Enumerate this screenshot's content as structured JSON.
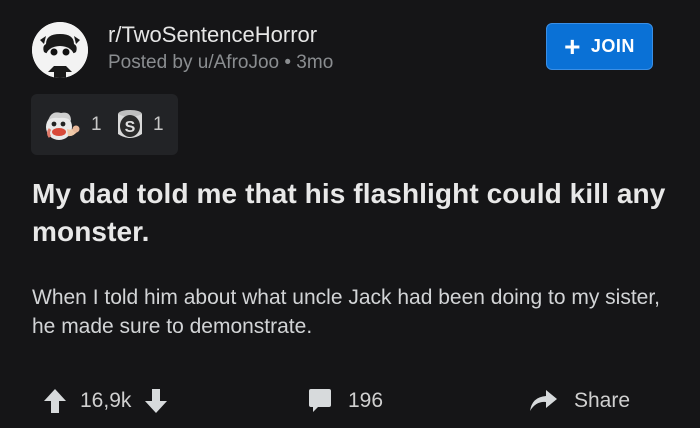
{
  "post": {
    "subreddit": "r/TwoSentenceHorror",
    "posted_by": "Posted by u/AfroJoo • 3mo",
    "join_label": "JOIN",
    "awards": [
      {
        "icon": "wholesome-award-icon",
        "count": "1"
      },
      {
        "icon": "silver-award-icon",
        "count": "1"
      }
    ],
    "title": "My dad told me that his flashlight could kill any monster.",
    "body": "When I told him about what uncle Jack had been doing to my sister, he made sure to demonstrate.",
    "votes": "16,9k",
    "comments": "196",
    "share_label": "Share"
  },
  "colors": {
    "background": "#151517",
    "accent": "#0a71d6",
    "text": "#d7dadc",
    "muted": "#8a8d90"
  }
}
